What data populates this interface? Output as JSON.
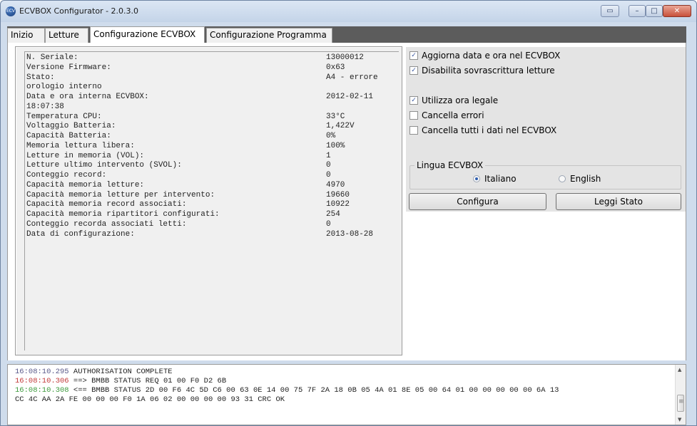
{
  "window": {
    "title": "ECVBOX Configurator - 2.0.3.0",
    "icon": "app-logo-icon",
    "icon_text": "ECV",
    "controls": [
      "restore",
      "minimize",
      "maximize",
      "close"
    ]
  },
  "tabs": [
    {
      "label": "Inizio",
      "active": false
    },
    {
      "label": "Letture",
      "active": false
    },
    {
      "label": "Configurazione ECVBOX",
      "active": true
    },
    {
      "label": "Configurazione Programma",
      "active": false
    }
  ],
  "status": {
    "rows": [
      {
        "label": "N. Seriale:",
        "value": "13000012"
      },
      {
        "label": "Versione Firmware:",
        "value": "0x63"
      },
      {
        "label": "Stato:",
        "value": "A4 - errore"
      },
      {
        "label": "orologio interno",
        "value": ""
      },
      {
        "label": "Data e ora interna ECVBOX:",
        "value": "2012-02-11"
      },
      {
        "label": "18:07:38",
        "value": ""
      },
      {
        "label": "Temperatura CPU:",
        "value": "33°C"
      },
      {
        "label": "Voltaggio Batteria:",
        "value": "1,422V"
      },
      {
        "label": "Capacità Batteria:",
        "value": "0%"
      },
      {
        "label": "Memoria lettura libera:",
        "value": "100%"
      },
      {
        "label": "Letture in memoria (VOL):",
        "value": "1"
      },
      {
        "label": "Letture ultimo intervento (SVOL):",
        "value": "0"
      },
      {
        "label": "Conteggio record:",
        "value": "0"
      },
      {
        "label": "Capacità memoria letture:",
        "value": "4970"
      },
      {
        "label": "Capacità memoria letture per intervento:",
        "value": "19660"
      },
      {
        "label": "Capacità memoria record associati:",
        "value": "10922"
      },
      {
        "label": "Capacità memoria ripartitori configurati:",
        "value": "254"
      },
      {
        "label": "Conteggio recorda associati letti:",
        "value": "0"
      },
      {
        "label": "Data di configurazione:",
        "value": "2013-08-28"
      }
    ]
  },
  "options": {
    "checkboxes": [
      {
        "label": "Aggiorna data e ora nel ECVBOX",
        "checked": true
      },
      {
        "label": "Disabilita sovrascrittura letture",
        "checked": true
      },
      {
        "label": "Utilizza ora legale",
        "checked": true
      },
      {
        "label": "Cancella errori",
        "checked": false
      },
      {
        "label": "Cancella tutti i dati nel ECVBOX",
        "checked": false
      }
    ],
    "language_group": {
      "title": "Lingua ECVBOX",
      "options": [
        {
          "label": "Italiano",
          "selected": true
        },
        {
          "label": "English",
          "selected": false
        }
      ]
    },
    "configure_button": "Configura",
    "read_status_button": "Leggi Stato"
  },
  "log": {
    "lines": [
      {
        "time": "16:08:10.295",
        "time_color": "#5a5a8a",
        "text": "     AUTHORISATION COMPLETE"
      },
      {
        "time": "16:08:10.306",
        "time_color": "#c23a3a",
        "text": " ==> BMBB STATUS REQ 01 00 F0 D2 6B"
      },
      {
        "time": "16:08:10.308",
        "time_color": "#3d9a3d",
        "text": " <== BMBB STATUS 2D 00 F6 4C 5D C6 00 63 0E 14 00 75 7F 2A 18 0B 05 4A 01 8E 05 00 64 01 00 00 00 00 00 6A 13"
      },
      {
        "time": "",
        "time_color": "#222222",
        "text": "CC 4C AA 2A FE 00 00 00 F0 1A 06 02 00 00 00 00 93 31   CRC OK"
      }
    ]
  },
  "colors": {
    "tab_strip": "#5c5c5c",
    "panel_bg": "#f0f0f0",
    "options_bg": "#e4e4e4",
    "checkmark": "#3a58a0"
  }
}
